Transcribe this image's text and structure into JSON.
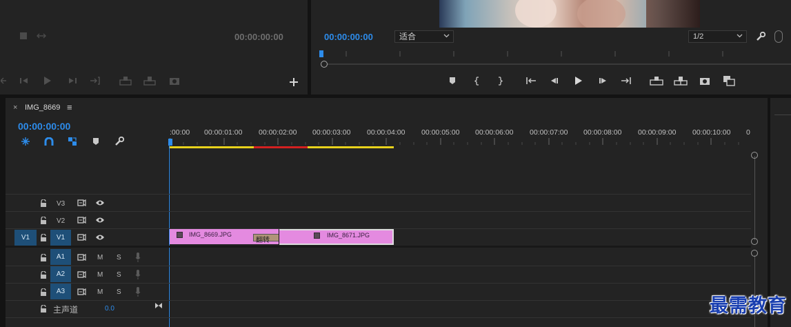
{
  "source_monitor": {
    "timecode": "00:00:00:00"
  },
  "program_monitor": {
    "timecode": "00:00:00:00",
    "fit_select": "适合",
    "resolution_select": "1/2"
  },
  "timeline": {
    "tab_close": "×",
    "tab_name": "IMG_8669",
    "tab_menu": "≡",
    "timecode": "00:00:00:00",
    "ruler": [
      ":00:00",
      "00:00:01:00",
      "00:00:02:00",
      "00:00:03:00",
      "00:00:04:00",
      "00:00:05:00",
      "00:00:06:00",
      "00:00:07:00",
      "00:00:08:00",
      "00:00:09:00",
      "00:00:10:00",
      "0"
    ],
    "tracks": {
      "v3": "V3",
      "v2": "V2",
      "v1_source": "V1",
      "v1": "V1",
      "a1": "A1",
      "a2": "A2",
      "a3": "A3",
      "mute": "M",
      "solo": "S",
      "master_label": "主声道",
      "master_value": "0.0"
    },
    "clips": {
      "clip1": "IMG_8669.JPG",
      "transition": "翻转",
      "clip2": "IMG_8671.JPG"
    }
  },
  "colors": {
    "accent_blue": "#2d8ceb",
    "clip_pink": "#e48ae0",
    "render_yellow": "#e8d21c",
    "render_red": "#d42020"
  },
  "watermark": "最需教育"
}
